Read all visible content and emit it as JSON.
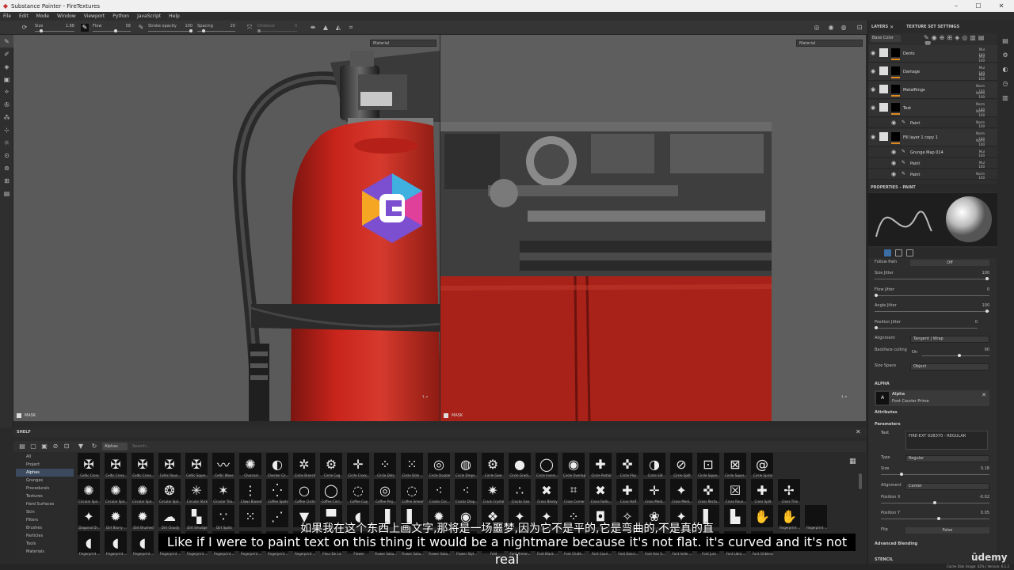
{
  "app": {
    "title": "Substance Painter - FireTextures"
  },
  "menu": [
    "File",
    "Edit",
    "Mode",
    "Window",
    "Viewport",
    "Python",
    "JavaScript",
    "Help"
  ],
  "toolbar": {
    "size_label": "Size",
    "size_value": "1.68",
    "flow_label": "Flow",
    "flow_value": "58",
    "opacity_label": "Stroke opacity",
    "opacity_value": "100",
    "spacing_label": "Spacing",
    "spacing_value": "20",
    "distance_label": "Distance",
    "distance_value": "0"
  },
  "viewport": {
    "material_label": "Material",
    "mask_label": "MASK"
  },
  "shelf": {
    "title": "SHELF",
    "filter_tag": "Alphas",
    "search_placeholder": "Search...",
    "categories": [
      "All",
      "Project",
      "Alphas",
      "Grunges",
      "Procedurals",
      "Textures",
      "Hard Surfaces",
      "Skin",
      "Filters",
      "Brushes",
      "Particles",
      "Tools",
      "Materials"
    ],
    "selected": "Alphas",
    "row1": [
      "Celtic Cross",
      "Celtic Cross...",
      "Celtic Cross...",
      "Celtic Roun...",
      "Celtic Squar...",
      "Celtic Wave",
      "Charcoal",
      "Checker Cir...",
      "Circle Branch",
      "Circle Cog",
      "Circle Cross...",
      "Circle Dots",
      "Circle Dots ...",
      "Circle Double",
      "Circle Drops...",
      "Circle Gear",
      "Circle Gradi...",
      "Circle Invers...",
      "Circle Overlap",
      "Circle Partial",
      "Circle Plus",
      "Circle Slit",
      "Circle Split",
      "Circle Squar...",
      "Circle Squar...",
      "Circle Spiral"
    ],
    "row2": [
      "Circular Spir...",
      "Circular Spir...",
      "Circular Spir...",
      "Circular Spir...",
      "Circular Stick",
      "Circular Tria...",
      "Claws Biased",
      "Coffee Spots",
      "Coffee Circle",
      "Coffee Circl...",
      "Coffee Cup",
      "Coffee Proj...",
      "Coffee Smear",
      "Cracks Circ...",
      "Cracks Drop...",
      "Crack Crystal",
      "Cracks Geo",
      "Cross Blocky",
      "Cross Corner",
      "Cross Fadin...",
      "Cross Half",
      "Cross Medi...",
      "Cross Medi...",
      "Cross Recta...",
      "Cross Roun...",
      "Cross Split",
      "Cross Thin"
    ],
    "row3": [
      "Diagonal Dr...",
      "Dirt Blurry ...",
      "Dirt Brushed",
      "Dirt Cloudy",
      "Dirt Smudge",
      "Dirt Spots",
      "",
      "",
      "",
      "",
      "",
      "",
      "",
      "",
      "",
      "",
      "",
      "",
      "",
      "",
      "",
      "",
      "",
      "",
      "",
      "",
      "Fingerprint ...",
      "Fingerprint ..."
    ],
    "row4": [
      "Fingerprint ...",
      "Fingerprint ...",
      "Fingerprint ...",
      "Fingerprint ...",
      "Fingerprint ...",
      "Fingerprint ...",
      "Fingerprint ...",
      "Fingerprint ...",
      "Fingerprint ...",
      "Fleur De Lis",
      "Flower",
      "Flower Saku...",
      "Flower Saku...",
      "Flower Saku...",
      "Flower Styl...",
      "Fold",
      "Font Armen...",
      "Font Black ...",
      "Font Chath...",
      "Font Couri...",
      "Font Danci...",
      "Font Han S...",
      "Font Indie ...",
      "Font Jura",
      "Font Libra ...",
      "Font Oribtron"
    ],
    "row1_glyphs": [
      "✠",
      "✠",
      "✠",
      "✠",
      "✠",
      "〰",
      "✺",
      "◐",
      "✲",
      "⚙",
      "✛",
      "⁘",
      "⁙",
      "◎",
      "◍",
      "⚙",
      "●",
      "◯",
      "◉",
      "✚",
      "✜",
      "◑",
      "⊘",
      "⊡",
      "⊠",
      "@"
    ],
    "row2_glyphs": [
      "✺",
      "✺",
      "✺",
      "❂",
      "✳",
      "✶",
      "⋮",
      "⁛",
      "○",
      "◯",
      "◌",
      "◎",
      "◌",
      "⁖",
      "⁖",
      "✷",
      "∴",
      "✖",
      "⌗",
      "✖",
      "✚",
      "✛",
      "✦",
      "✜",
      "☒",
      "✚",
      "✢"
    ],
    "row3_glyphs": [
      "✦",
      "✹",
      "✹",
      "☁",
      "▚",
      "∵",
      "⁙",
      "⋰",
      "▼",
      "▀",
      "◖",
      "▐",
      "▌",
      "✹",
      "◉",
      "❖",
      "✦",
      "✦",
      "⁘",
      "◘",
      "✧",
      "❀",
      "✦",
      "▌",
      "▙",
      "✋",
      "✋"
    ],
    "row4_glyphs": [
      "◖",
      "◖",
      "◖",
      "",
      "",
      "",
      "",
      "",
      "",
      "",
      "",
      "",
      "",
      "",
      "",
      "",
      "",
      "",
      "",
      "",
      "",
      "",
      "",
      "",
      "",
      ""
    ]
  },
  "layers": {
    "tab_layers": "LAYERS",
    "tab_texture": "TEXTURE SET SETTINGS",
    "channel": "Base Color",
    "items": [
      {
        "name": "Dents",
        "blend": "Mul",
        "opacity": "100",
        "blend2": "Mul",
        "opacity2": "100",
        "sub": false
      },
      {
        "name": "Damage",
        "blend": "Mul",
        "opacity": "100",
        "blend2": "Mul",
        "opacity2": "100",
        "sub": false
      },
      {
        "name": "MetalRings",
        "blend": "Norm",
        "opacity": "100",
        "blend2": "Norm",
        "opacity2": "100",
        "sub": false
      },
      {
        "name": "Text",
        "blend": "Norm",
        "opacity": "100",
        "blend2": "Norm",
        "opacity2": "100",
        "sub": false
      },
      {
        "name": "Paint",
        "blend": "Norm",
        "opacity": "100",
        "blend2": "",
        "opacity2": "",
        "sub": true
      },
      {
        "name": "Fill layer 1 copy 1",
        "blend": "Norm",
        "opacity": "100",
        "blend2": "Norm",
        "opacity2": "100",
        "sub": false
      },
      {
        "name": "Grunge Map 014",
        "blend": "Mul",
        "opacity": "100",
        "blend2": "",
        "opacity2": "",
        "sub": true
      },
      {
        "name": "Paint",
        "blend": "Mul",
        "opacity": "100",
        "blend2": "",
        "opacity2": "",
        "sub": true
      },
      {
        "name": "Paint",
        "blend": "Norm",
        "opacity": "100",
        "blend2": "",
        "opacity2": "",
        "sub": true
      }
    ]
  },
  "properties": {
    "title": "PROPERTIES - PAINT",
    "follow_path_label": "Follow Path",
    "follow_path_value": "Off",
    "size_jitter_label": "Size Jitter",
    "size_jitter_value": "100",
    "flow_jitter_label": "Flow Jitter",
    "flow_jitter_value": "0",
    "angle_jitter_label": "Angle Jitter",
    "angle_jitter_value": "100",
    "position_jitter_label": "Position Jitter",
    "position_jitter_value": "0",
    "alignment_label": "Alignment",
    "alignment_value": "Tangent | Wrap",
    "backface_label": "Backface culling",
    "backface_on": "On",
    "backface_value": "90",
    "size_space_label": "Size Space",
    "size_space_value": "Object",
    "alpha_section": "ALPHA",
    "alpha_name": "Alpha",
    "alpha_font": "Font Courier Prime",
    "attributes": "Attributes",
    "parameters": "Parameters",
    "text_label": "Text",
    "text_value": "FIRE-EXT 92B370 - REGULAR",
    "type_label": "Type",
    "type_value": "Regular",
    "size_label": "Size",
    "size_value": "0.18",
    "alignment2_label": "Alignment",
    "alignment2_value": "Center",
    "posx_label": "Position X",
    "posx_value": "-0.02",
    "posy_label": "Position Y",
    "posy_value": "0.05",
    "flip_label": "Flip",
    "flip_value": "False",
    "advanced_blending": "Advanced Blending",
    "stencil": "STENCIL"
  },
  "subtitles": {
    "cn": "如果我在这个东西上画文字,那将是一场噩梦,因为它不是平的,它是弯曲的,不是真的直",
    "en": "Like if I were to paint text on this thing it would be a nightmare because it's not flat. it's curved and it's not real"
  },
  "status": {
    "text": "Cache Disk Usage: 42% | Version: 6.1.2"
  },
  "watermark": "ūdemy",
  "colors": {
    "accent": "#e08a1e",
    "selection": "#3b4a5f",
    "extinguisher_red": "#c8241b"
  }
}
